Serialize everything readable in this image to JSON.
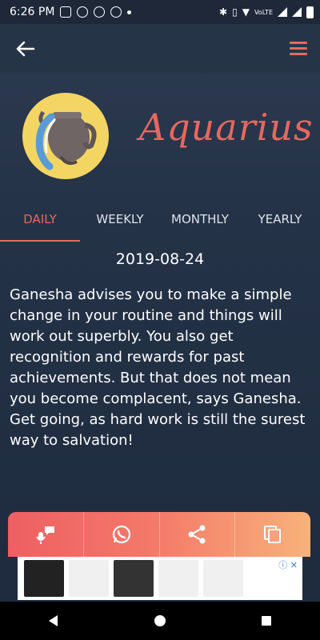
{
  "status_bar": {
    "time": "6:26 PM",
    "network_label": "VoLTE"
  },
  "app_bar": {
    "back_icon": "arrow-left-icon",
    "menu_icon": "hamburger-menu-icon",
    "accent": "#e8685e"
  },
  "sign": {
    "name": "Aquarius",
    "icon": "aquarius-jar-icon",
    "circle_color": "#f3d563"
  },
  "tabs": [
    {
      "label": "DAILY",
      "active": true
    },
    {
      "label": "WEEKLY",
      "active": false
    },
    {
      "label": "MONTHLY",
      "active": false
    },
    {
      "label": "YEARLY",
      "active": false
    }
  ],
  "date": "2019-08-24",
  "horoscope": "Ganesha advises you to make a simple change in your routine and things will work out superbly. You also get recognition and rewards for past achievements. But that does not mean you become complacent, says Ganesha. Get going, as hard work is still the surest way to salvation!",
  "actions": [
    {
      "icon": "voice-icon"
    },
    {
      "icon": "whatsapp-icon"
    },
    {
      "icon": "share-icon"
    },
    {
      "icon": "copy-icon"
    }
  ],
  "nav": {
    "back_icon": "nav-back-icon",
    "home_icon": "nav-home-icon",
    "recents_icon": "nav-recents-icon"
  }
}
